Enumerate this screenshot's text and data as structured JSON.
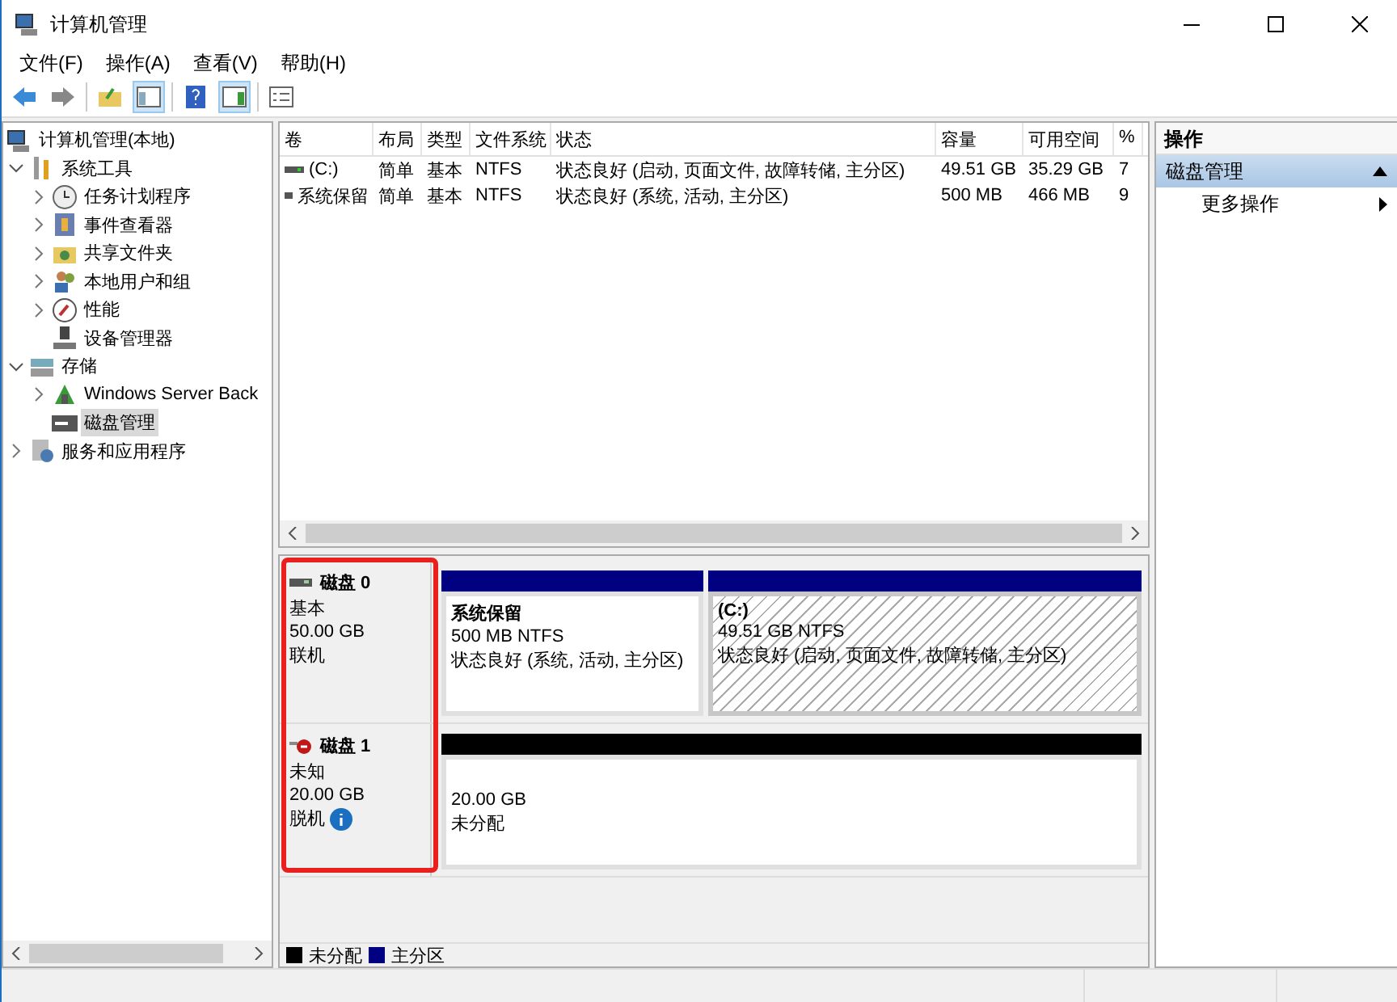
{
  "window": {
    "title": "计算机管理"
  },
  "menu": [
    "文件(F)",
    "操作(A)",
    "查看(V)",
    "帮助(H)"
  ],
  "tree": [
    {
      "label": "计算机管理(本地)",
      "kind": "computer",
      "selected": false,
      "children": [
        {
          "label": "系统工具",
          "kind": "tools",
          "expanded": true,
          "selected": false,
          "children": [
            {
              "label": "任务计划程序",
              "kind": "clock",
              "expanded": false,
              "selected": false
            },
            {
              "label": "事件查看器",
              "kind": "event",
              "expanded": false,
              "selected": false
            },
            {
              "label": "共享文件夹",
              "kind": "share",
              "expanded": false,
              "selected": false
            },
            {
              "label": "本地用户和组",
              "kind": "users",
              "expanded": false,
              "selected": false
            },
            {
              "label": "性能",
              "kind": "perf",
              "expanded": false,
              "selected": false
            },
            {
              "label": "设备管理器",
              "kind": "device",
              "selected": false
            }
          ]
        },
        {
          "label": "存储",
          "kind": "storage",
          "expanded": true,
          "selected": false,
          "children": [
            {
              "label": "Windows Server Back",
              "kind": "backup",
              "expanded": false,
              "selected": false
            },
            {
              "label": "磁盘管理",
              "kind": "disk",
              "selected": true
            }
          ]
        },
        {
          "label": "服务和应用程序",
          "kind": "services",
          "expanded": false,
          "selected": false
        }
      ]
    }
  ],
  "volumes": {
    "columns": [
      "卷",
      "布局",
      "类型",
      "文件系统",
      "状态",
      "容量",
      "可用空间",
      "%"
    ],
    "rows": [
      [
        "(C:)",
        "简单",
        "基本",
        "NTFS",
        "状态良好 (启动, 页面文件, 故障转储, 主分区)",
        "49.51 GB",
        "35.29 GB",
        "7"
      ],
      [
        "系统保留",
        "简单",
        "基本",
        "NTFS",
        "状态良好 (系统, 活动, 主分区)",
        "500 MB",
        "466 MB",
        "9"
      ]
    ]
  },
  "disks": [
    {
      "name": "磁盘 0",
      "kind": "online",
      "type": "基本",
      "size": "50.00 GB",
      "status": "联机",
      "info": false,
      "partitions": [
        {
          "kind": "primary",
          "name": "系统保留",
          "size": "500 MB NTFS",
          "status": "状态良好 (系统, 活动, 主分区)",
          "selected": false
        },
        {
          "kind": "primary",
          "name": "(C:)",
          "size": "49.51 GB NTFS",
          "status": "状态良好 (启动, 页面文件, 故障转储, 主分区)",
          "selected": true
        }
      ]
    },
    {
      "name": "磁盘 1",
      "kind": "offline",
      "type": "未知",
      "size": "20.00 GB",
      "status": "脱机",
      "info": true,
      "partitions": [
        {
          "kind": "unallocated",
          "size": "20.00 GB",
          "status": "未分配",
          "selected": false
        }
      ]
    }
  ],
  "legend": [
    {
      "label": "未分配",
      "color": "#000000"
    },
    {
      "label": "主分区",
      "color": "#000080"
    }
  ],
  "actions": {
    "title": "操作",
    "sections": [
      {
        "title": "磁盘管理",
        "expanded": true,
        "items": [
          "更多操作"
        ]
      }
    ]
  }
}
